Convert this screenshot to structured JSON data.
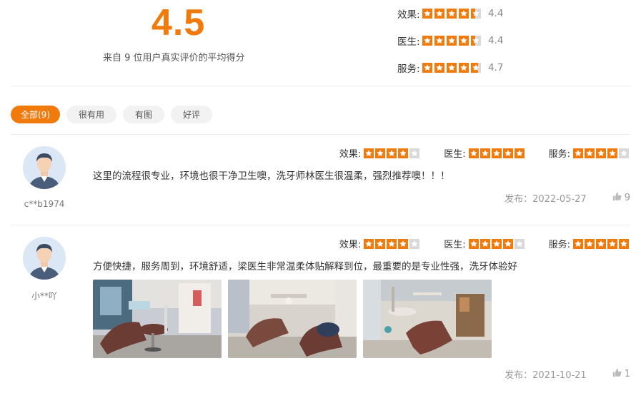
{
  "summary": {
    "average": "4.5",
    "description": "来自 9 位用户真实评价的平均得分",
    "ratings": [
      {
        "label": "效果:",
        "value": "4.4",
        "score": 4.4
      },
      {
        "label": "医生:",
        "value": "4.4",
        "score": 4.4
      },
      {
        "label": "服务:",
        "value": "4.7",
        "score": 4.7
      }
    ]
  },
  "tabs": [
    {
      "label": "全部(9)",
      "active": true
    },
    {
      "label": "很有用",
      "active": false
    },
    {
      "label": "有图",
      "active": false
    },
    {
      "label": "好评",
      "active": false
    }
  ],
  "reviews": [
    {
      "username": "c**b1974",
      "scores": [
        {
          "label": "效果:",
          "score": 4
        },
        {
          "label": "医生:",
          "score": 5
        },
        {
          "label": "服务:",
          "score": 4
        }
      ],
      "text": "这里的流程很专业，环境也很干净卫生噢，洗牙师林医生很温柔，强烈推荐噢！！！",
      "date": "发布：2022-05-27",
      "likes": "9",
      "photos": []
    },
    {
      "username": "小**吖",
      "scores": [
        {
          "label": "效果:",
          "score": 4
        },
        {
          "label": "医生:",
          "score": 4
        },
        {
          "label": "服务:",
          "score": 5
        }
      ],
      "text": "方便快捷，服务周到，环境舒适，梁医生非常温柔体贴解释到位，最重要的是专业性强，洗牙体验好",
      "date": "发布：2021-10-21",
      "likes": "1",
      "photos": [
        "dental-clinic-photo-1",
        "dental-clinic-photo-2",
        "dental-clinic-photo-3"
      ]
    }
  ],
  "colors": {
    "accent": "#f07a0c",
    "star_empty": "#d9d9d9",
    "text": "#333333",
    "muted": "#999999"
  },
  "icons": {
    "star": "star-icon",
    "like": "thumbs-up-icon",
    "avatar": "user-avatar-icon"
  }
}
